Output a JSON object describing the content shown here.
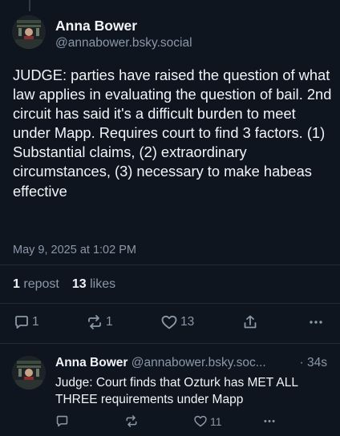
{
  "post": {
    "author_name": "Anna Bower",
    "author_handle": "@annabower.bsky.social",
    "text": "JUDGE: parties have raised the question of what law applies in evaluating the question of bail. 2nd circuit has said it's a difficult burden to meet under Mapp. Requires court to find 3 factors. (1) Substantial claims, (2) extraordinary circumstances, (3) necessary to make habeas effective",
    "timestamp": "May 9, 2025 at 1:02 PM",
    "stats": {
      "reposts_count": "1",
      "reposts_label": "repost",
      "likes_count": "13",
      "likes_label": "likes"
    },
    "actions": {
      "reply_count": "1",
      "repost_count": "1",
      "like_count": "13"
    }
  },
  "reply": {
    "author_name": "Anna Bower",
    "author_handle": "@annabower.bsky.soc...",
    "time": "· 34s",
    "text": "Judge: Court finds that Ozturk has MET ALL THREE requirements under Mapp",
    "actions": {
      "like_count": "11"
    }
  },
  "icons": {
    "reply": "speech-bubble-icon",
    "repost": "repost-arrows-icon",
    "like": "heart-icon",
    "share": "share-icon",
    "more": "ellipsis-icon"
  },
  "colors": {
    "background": "#0e151e",
    "text": "#f1f4f8",
    "secondary": "#8b98a8",
    "divider": "#222c38"
  }
}
